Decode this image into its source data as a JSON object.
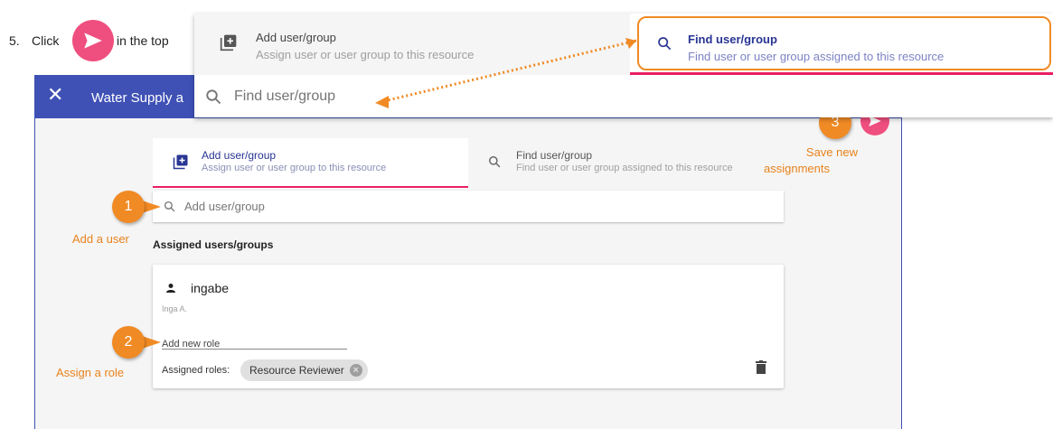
{
  "instruction": {
    "step_number": "5.",
    "click_word": "Click",
    "rest_text": "in the top"
  },
  "dialog": {
    "close_glyph": "✕",
    "title": "Water Supply a"
  },
  "tabs": [
    {
      "title": "Add user/group",
      "subtitle": "Assign user or user group to this resource",
      "active": true
    },
    {
      "title": "Find user/group",
      "subtitle": "Find user or user group assigned to this resource",
      "active": false
    }
  ],
  "search": {
    "placeholder": "Add user/group"
  },
  "assigned_heading": "Assigned users/groups",
  "user": {
    "username": "ingabe",
    "display_name": "Inga A.",
    "role_input_placeholder": "Add new role",
    "roles_label": "Assigned roles:",
    "roles": [
      "Resource Reviewer"
    ]
  },
  "callouts": [
    {
      "number": "1",
      "label": "Add a user"
    },
    {
      "number": "2",
      "label": "Assign a role"
    },
    {
      "number": "3",
      "label_line1": "Save new",
      "label_line2": "assignments"
    }
  ],
  "overlay": {
    "tab_left": {
      "title": "Add user/group",
      "subtitle": "Assign user or user group to this resource"
    },
    "tab_right": {
      "title": "Find user/group",
      "subtitle": "Find user or user group assigned to this resource"
    },
    "search_placeholder": "Find user/group"
  },
  "colors": {
    "header": "#3f51b5",
    "accent_pink": "#e91e63",
    "send_button": "#ef4f7e",
    "callout_orange": "#f08a24"
  },
  "icons": {
    "send": "send-icon",
    "close": "close-icon",
    "add_box": "add-box-icon",
    "search": "search-icon",
    "person": "person-icon",
    "delete": "trash-icon"
  }
}
